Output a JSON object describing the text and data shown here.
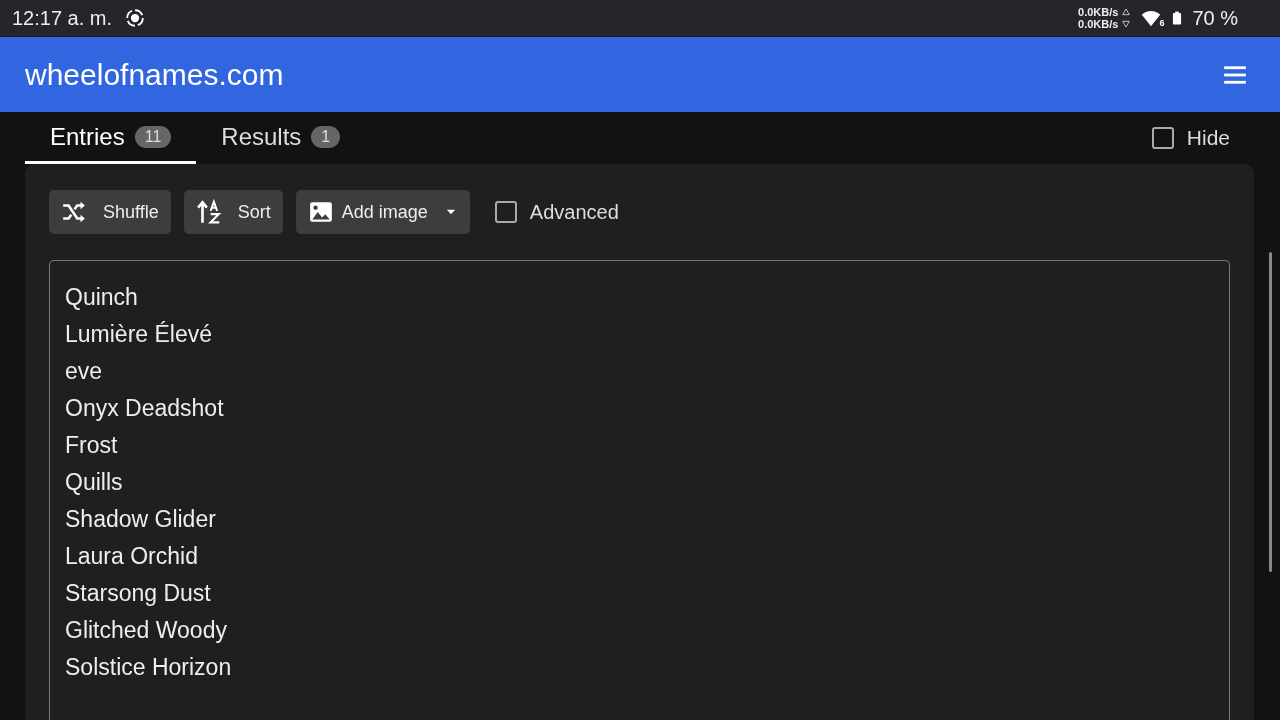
{
  "status_bar": {
    "time": "12:17 a. m.",
    "upload_speed": "0.0KB/s",
    "download_speed": "0.0KB/s",
    "wifi_badge": "6",
    "battery": "70 %"
  },
  "header": {
    "title": "wheelofnames.com"
  },
  "tabs": [
    {
      "label": "Entries",
      "count": "11",
      "selected": true
    },
    {
      "label": "Results",
      "count": "1",
      "selected": false
    }
  ],
  "hide": {
    "label": "Hide",
    "checked": false
  },
  "toolbar": {
    "buttons": [
      {
        "kind": "shuffle",
        "label": "Shuffle"
      },
      {
        "kind": "sort",
        "label": "Sort"
      },
      {
        "kind": "image",
        "label": "Add image"
      }
    ],
    "advanced": {
      "label": "Advanced",
      "checked": false
    }
  },
  "entries": [
    "Quinch",
    "Lumière Élevé",
    "eve",
    "Onyx Deadshot",
    "Frost",
    "Quills",
    "Shadow Glider",
    "Laura Orchid",
    "Starsong Dust",
    "Glitched Woody",
    "Solstice Horizon"
  ]
}
